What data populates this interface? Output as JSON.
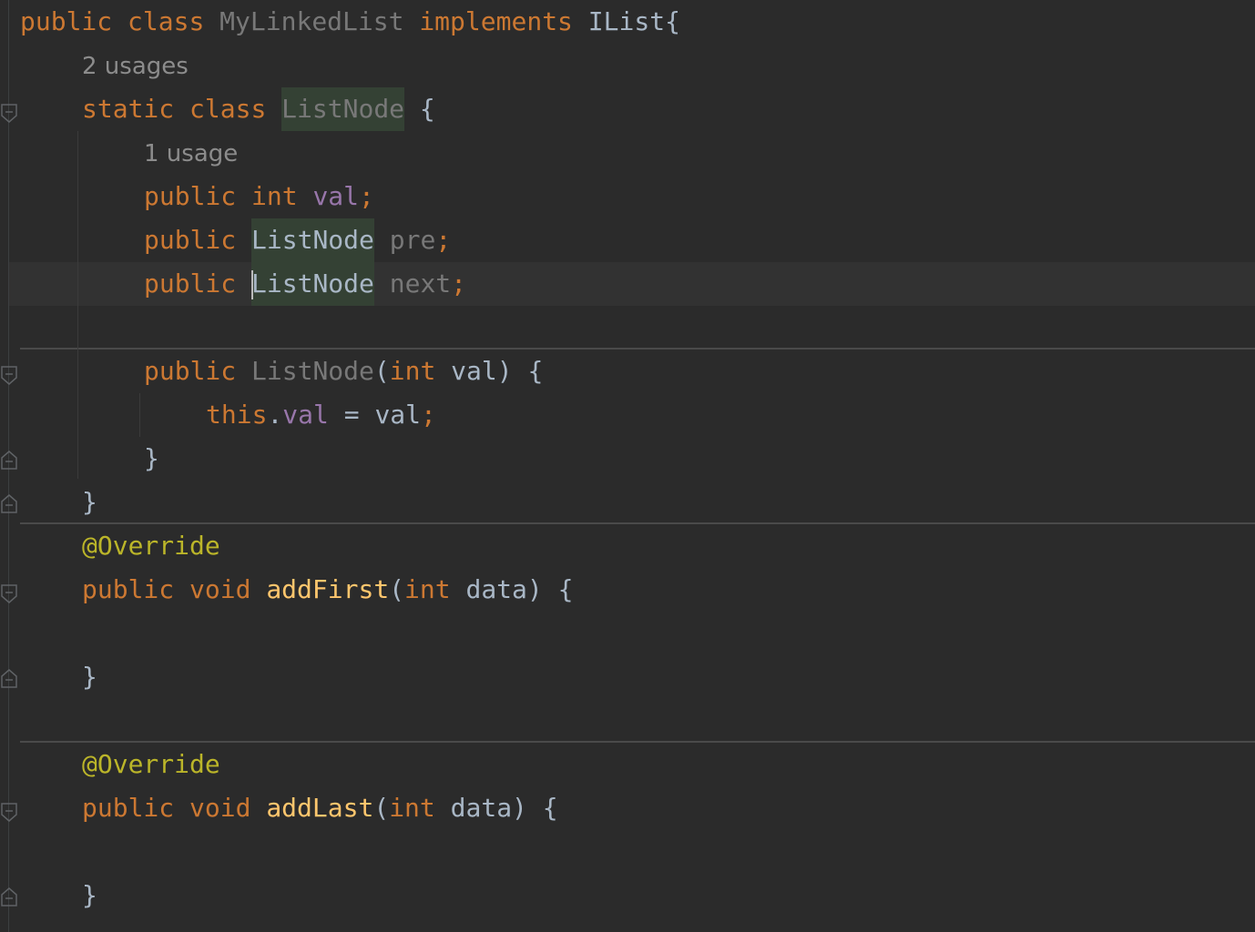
{
  "editor": {
    "lines": [
      {
        "row": 0,
        "indent": 0,
        "tokens": [
          [
            "kw",
            "public "
          ],
          [
            "kw",
            "class "
          ],
          [
            "dim",
            "MyLinkedList "
          ],
          [
            "kw",
            "implements "
          ],
          [
            "cls",
            "IList"
          ],
          [
            "pl",
            "{"
          ]
        ]
      },
      {
        "row": 1,
        "indent": 1,
        "usage": "2 usages"
      },
      {
        "row": 2,
        "indent": 1,
        "tokens": [
          [
            "kw",
            "static "
          ],
          [
            "kw",
            "class "
          ],
          [
            "dimhl",
            "ListNode"
          ],
          [
            "pl",
            " {"
          ]
        ]
      },
      {
        "row": 3,
        "indent": 2,
        "usage": "1 usage"
      },
      {
        "row": 4,
        "indent": 2,
        "tokens": [
          [
            "kw",
            "public "
          ],
          [
            "kw",
            "int "
          ],
          [
            "fld",
            "val"
          ],
          [
            "sem",
            ";"
          ]
        ]
      },
      {
        "row": 5,
        "indent": 2,
        "tokens": [
          [
            "kw",
            "public "
          ],
          [
            "hl",
            "ListNode"
          ],
          [
            "dim",
            " pre"
          ],
          [
            "sem",
            ";"
          ]
        ]
      },
      {
        "row": 6,
        "indent": 2,
        "tokens": [
          [
            "kw",
            "public "
          ],
          [
            "caret",
            ""
          ],
          [
            "hl",
            "ListNode"
          ],
          [
            "dim",
            " next"
          ],
          [
            "sem",
            ";"
          ]
        ]
      },
      {
        "row": 8,
        "indent": 2,
        "tokens": [
          [
            "kw",
            "public "
          ],
          [
            "dim",
            "ListNode"
          ],
          [
            "pl",
            "("
          ],
          [
            "kw",
            "int "
          ],
          [
            "pl",
            "val) {"
          ]
        ]
      },
      {
        "row": 9,
        "indent": 3,
        "tokens": [
          [
            "kw",
            "this"
          ],
          [
            "pl",
            "."
          ],
          [
            "fld",
            "val"
          ],
          [
            "pl",
            " = val"
          ],
          [
            "sem",
            ";"
          ]
        ]
      },
      {
        "row": 10,
        "indent": 2,
        "tokens": [
          [
            "pl",
            "}"
          ]
        ]
      },
      {
        "row": 11,
        "indent": 1,
        "tokens": [
          [
            "pl",
            "}"
          ]
        ]
      },
      {
        "row": 12,
        "indent": 1,
        "tokens": [
          [
            "ann",
            "@Override"
          ]
        ]
      },
      {
        "row": 13,
        "indent": 1,
        "tokens": [
          [
            "kw",
            "public "
          ],
          [
            "kw",
            "void "
          ],
          [
            "fn",
            "addFirst"
          ],
          [
            "pl",
            "("
          ],
          [
            "kw",
            "int "
          ],
          [
            "pl",
            "data) {"
          ]
        ]
      },
      {
        "row": 15,
        "indent": 1,
        "tokens": [
          [
            "pl",
            "}"
          ]
        ]
      },
      {
        "row": 17,
        "indent": 1,
        "tokens": [
          [
            "ann",
            "@Override"
          ]
        ]
      },
      {
        "row": 18,
        "indent": 1,
        "tokens": [
          [
            "kw",
            "public "
          ],
          [
            "kw",
            "void "
          ],
          [
            "fn",
            "addLast"
          ],
          [
            "pl",
            "("
          ],
          [
            "kw",
            "int "
          ],
          [
            "pl",
            "data) {"
          ]
        ]
      },
      {
        "row": 20,
        "indent": 1,
        "tokens": [
          [
            "pl",
            "}"
          ]
        ]
      }
    ]
  }
}
